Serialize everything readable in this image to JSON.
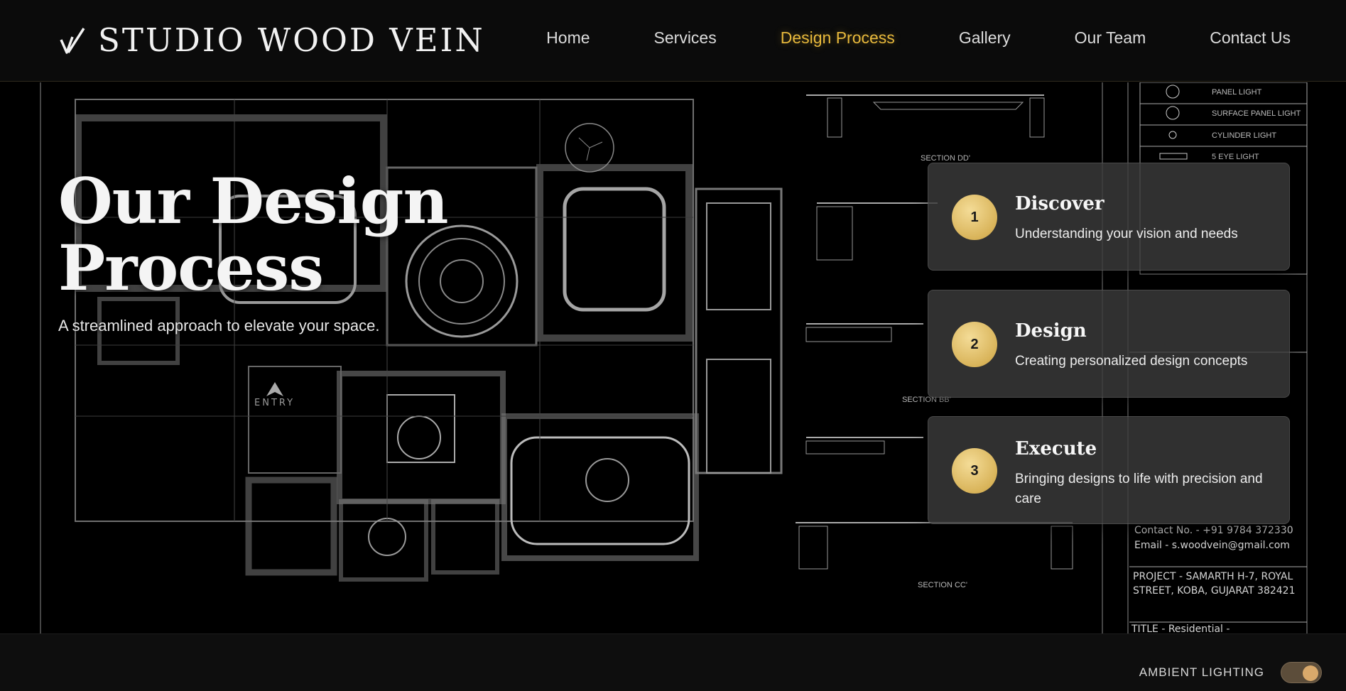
{
  "header": {
    "brand": "STUDIO WOOD VEIN",
    "logo_icon": "wood-vein-logo-icon",
    "nav": [
      {
        "label": "Home",
        "active": false
      },
      {
        "label": "Services",
        "active": false
      },
      {
        "label": "Design Process",
        "active": true
      },
      {
        "label": "Gallery",
        "active": false
      },
      {
        "label": "Our Team",
        "active": false
      },
      {
        "label": "Contact Us",
        "active": false
      }
    ]
  },
  "hero": {
    "title": "Our Design Process",
    "subtitle": "A streamlined approach to elevate your space."
  },
  "steps": [
    {
      "number": "1",
      "title": "Discover",
      "description": "Understanding your vision and needs"
    },
    {
      "number": "2",
      "title": "Design",
      "description": "Creating personalized design concepts"
    },
    {
      "number": "3",
      "title": "Execute",
      "description": "Bringing designs to life with precision and care"
    }
  ],
  "blueprint": {
    "legend": [
      "PANEL LIGHT",
      "SURFACE PANEL LIGHT",
      "CYLINDER LIGHT",
      "5 EYE LIGHT"
    ],
    "sections": [
      "SECTION DD'",
      "SECTION BB'",
      "SECTION CC'"
    ],
    "entry": "ENTRY",
    "contact_no": "Contact No. - +91 9784 372330",
    "email": "Email - s.woodvein@gmail.com",
    "project_line1": "PROJECT - SAMARTH H-7, ROYAL",
    "project_line2": "STREET, KOBA, GUJARAT 382421",
    "title_block": "TITLE - Residential -"
  },
  "ambient": {
    "label": "AMBIENT LIGHTING",
    "enabled": true
  },
  "colors": {
    "accent": "#e8b93c",
    "background": "#000000",
    "card": "#3a3a3a",
    "step_badge": "#e2c06c"
  }
}
